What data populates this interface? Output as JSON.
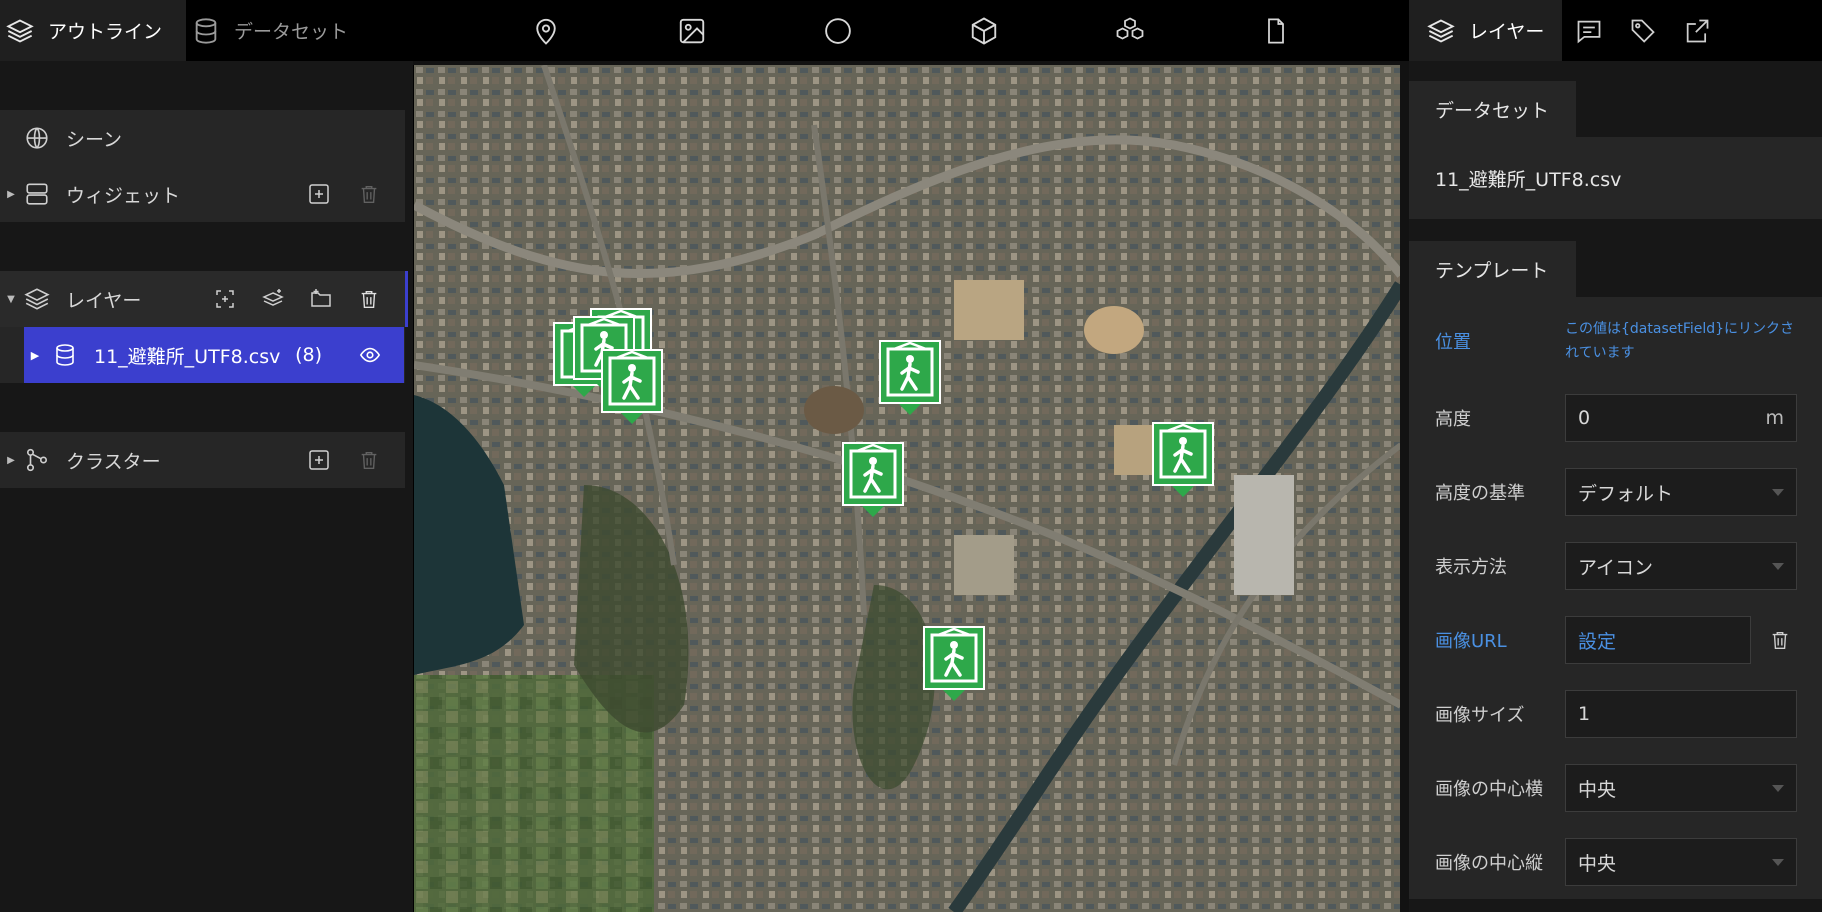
{
  "left_panel": {
    "tabs": [
      {
        "label": "アウトライン",
        "icon": "layers-icon"
      },
      {
        "label": "データセット",
        "icon": "database-icon"
      }
    ],
    "scene_label": "シーン",
    "widget_label": "ウィジェット",
    "layer_group_label": "レイヤー",
    "layer_item": {
      "name": "11_避難所_UTF8.csv",
      "count": "(8)"
    },
    "cluster_label": "クラスター"
  },
  "toolbar": {
    "tools": [
      "marker-icon",
      "image-icon",
      "circle-icon",
      "box-icon",
      "model-icon",
      "file-icon"
    ]
  },
  "map": {
    "marker_icon": "evacuation-shelter-icon",
    "marker_color": "#2ea84a"
  },
  "right_panel": {
    "tab_label": "レイヤー",
    "tab_icons": [
      "layers-icon",
      "infobox-icon",
      "tag-icon",
      "export-icon"
    ],
    "dataset_header": "データセット",
    "dataset_file": "11_避難所_UTF8.csv",
    "template_header": "テンプレート",
    "fields": {
      "position_label": "位置",
      "position_note": "この値は{datasetField}にリンクされています",
      "height_label": "高度",
      "height_value": "0",
      "height_unit": "m",
      "height_ref_label": "高度の基準",
      "height_ref_value": "デフォルト",
      "display_label": "表示方法",
      "display_value": "アイコン",
      "image_url_label": "画像URL",
      "image_url_value": "設定",
      "image_size_label": "画像サイズ",
      "image_size_value": "1",
      "image_center_x_label": "画像の中心横",
      "image_center_x_value": "中央",
      "image_center_y_label": "画像の中心縦",
      "image_center_y_value": "中央"
    }
  }
}
